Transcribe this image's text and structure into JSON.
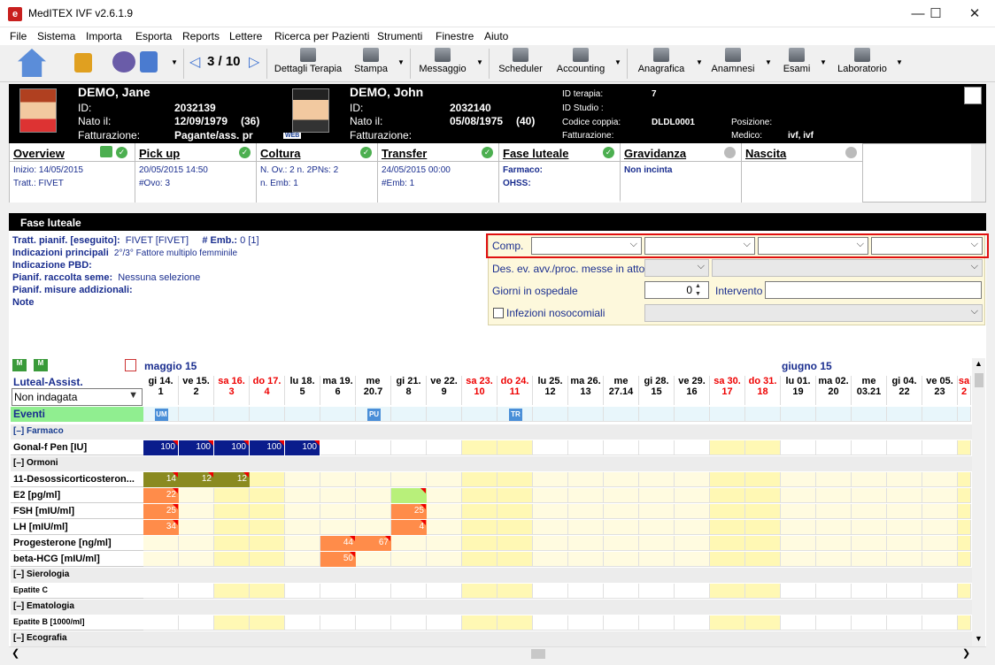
{
  "window": {
    "title": "MedITEX IVF v2.6.1.9",
    "minimize": "—",
    "maximize": "☐",
    "close": "✕"
  },
  "menu": [
    "File",
    "Sistema",
    "Importa",
    "Esporta",
    "Reports",
    "Lettere",
    "Ricerca per Pazienti",
    "Strumenti",
    "Finestre",
    "Aiuto"
  ],
  "toolbar": {
    "counter": "3 / 10",
    "dettagli": "Dettagli Terapia",
    "stampa": "Stampa",
    "messaggio": "Messaggio",
    "scheduler": "Scheduler",
    "accounting": "Accounting",
    "anagrafica": "Anagrafica",
    "anamnesi": "Anamnesi",
    "esami": "Esami",
    "laboratorio": "Laboratorio"
  },
  "female": {
    "name": "DEMO, Jane",
    "id_label": "ID:",
    "id": "2032139",
    "dob_label": "Nato il:",
    "dob": "12/09/1979",
    "age": "(36)",
    "billing_label": "Fatturazione:",
    "billing": "Pagante/ass. pr"
  },
  "male": {
    "name": "DEMO, John",
    "id_label": "ID:",
    "id": "2032140",
    "dob_label": "Nato il:",
    "dob": "05/08/1975",
    "age": "(40)",
    "billing_label": "Fatturazione:",
    "web": "WEB"
  },
  "couple": {
    "therapy_label": "ID terapia:",
    "therapy": "7",
    "study_label": "ID Studio :",
    "code_label": "Codice coppia:",
    "code": "DLDL0001",
    "billing_label": "Fatturazione:",
    "position_label": "Posizione:",
    "doctor_label": "Medico:",
    "doctor": "ivf, ivf"
  },
  "phases": [
    {
      "title": "Overview",
      "l1": "Inizio:  14/05/2015",
      "l2": "Tratt.: FIVET"
    },
    {
      "title": "Pick up",
      "l1": "20/05/2015 14:50",
      "l2": "#Ovo: 3"
    },
    {
      "title": "Coltura",
      "l1": "N. Ov.: 2 n. 2PNs: 2",
      "l2": "n. Emb: 1"
    },
    {
      "title": "Transfer",
      "l1": "24/05/2015 00:00",
      "l2": "#Emb: 1"
    },
    {
      "title": "Fase luteale",
      "l1": "Farmaco:",
      "l2": "OHSS:"
    },
    {
      "title": "Gravidanza",
      "l1": "Non incinta",
      "l2": ""
    },
    {
      "title": "Nascita",
      "l1": "",
      "l2": ""
    }
  ],
  "section": {
    "title": "Fase luteale"
  },
  "info": {
    "tratt_label": "Tratt. pianif. [eseguito]:",
    "tratt": "FIVET    [FIVET]",
    "emb_label": "# Emb.:",
    "emb": "0    [1]",
    "indic_label": "Indicazioni principali",
    "indic": "2°/3° Fattore multiplo femminile",
    "pbd_label": "Indicazione PBD:",
    "seme_label": "Pianif. raccolta seme:",
    "seme": "Nessuna selezione",
    "misure_label": "Pianif. misure addizionali:",
    "note_label": "Note"
  },
  "form": {
    "comp_label": "Comp.",
    "des_label": "Des. ev. avv./proc. messe in atto",
    "giorni_label": "Giorni in ospedale",
    "giorni_value": "0",
    "intervento_label": "Intervento",
    "infezioni_label": "Infezioni nosocomiali"
  },
  "grid": {
    "month1": "maggio 15",
    "month2": "giugno 15",
    "luteal_label": "Luteal-Assist.",
    "luteal_value": "Non indagata",
    "days": [
      {
        "d": "gi 14.",
        "n": "1",
        "we": false
      },
      {
        "d": "ve 15.",
        "n": "2",
        "we": false
      },
      {
        "d": "sa 16.",
        "n": "3",
        "we": true
      },
      {
        "d": "do 17.",
        "n": "4",
        "we": true
      },
      {
        "d": "lu 18.",
        "n": "5",
        "we": false
      },
      {
        "d": "ma 19.",
        "n": "6",
        "we": false
      },
      {
        "d": "me",
        "n": "20.7",
        "we": false
      },
      {
        "d": "gi 21.",
        "n": "8",
        "we": false
      },
      {
        "d": "ve 22.",
        "n": "9",
        "we": false
      },
      {
        "d": "sa 23.",
        "n": "10",
        "we": true
      },
      {
        "d": "do 24.",
        "n": "11",
        "we": true
      },
      {
        "d": "lu 25.",
        "n": "12",
        "we": false
      },
      {
        "d": "ma 26.",
        "n": "13",
        "we": false
      },
      {
        "d": "me",
        "n": "27.14",
        "we": false
      },
      {
        "d": "gi 28.",
        "n": "15",
        "we": false
      },
      {
        "d": "ve 29.",
        "n": "16",
        "we": false
      },
      {
        "d": "sa 30.",
        "n": "17",
        "we": true
      },
      {
        "d": "do 31.",
        "n": "18",
        "we": true
      },
      {
        "d": "lu 01.",
        "n": "19",
        "we": false
      },
      {
        "d": "ma 02.",
        "n": "20",
        "we": false
      },
      {
        "d": "me",
        "n": "03.21",
        "we": false
      },
      {
        "d": "gi 04.",
        "n": "22",
        "we": false
      },
      {
        "d": "ve 05.",
        "n": "23",
        "we": false
      },
      {
        "d": "sa",
        "n": "2",
        "we": true
      }
    ],
    "eventi_label": "Eventi",
    "events": [
      {
        "day": 0,
        "label": "UM"
      },
      {
        "day": 6,
        "label": "PU"
      },
      {
        "day": 10,
        "label": "TR"
      }
    ],
    "farmaco_group": "[–]  Farmaco",
    "gonal_label": "Gonal-f Pen [IU]",
    "gonal_values": [
      "100",
      "100",
      "100",
      "100",
      "100"
    ],
    "ormoni_group": "[–]  Ormoni",
    "hormones": [
      {
        "label": "11-Desossicorticosteron...",
        "values": {
          "0": "14",
          "1": "12",
          "2": "12"
        }
      },
      {
        "label": "E2  [pg/ml]",
        "values": {
          "0": "22"
        }
      },
      {
        "label": "FSH  [mIU/ml]",
        "values": {
          "0": "25",
          "7": "25"
        }
      },
      {
        "label": "LH  [mIU/ml]",
        "values": {
          "0": "34",
          "7": "4"
        }
      },
      {
        "label": "Progesterone  [ng/ml]",
        "values": {
          "5": "44",
          "6": "67"
        }
      },
      {
        "label": "beta-HCG  [mIU/ml]",
        "values": {
          "5": "50"
        }
      }
    ],
    "sierologia_group": "[–]  Sierologia",
    "epatite_c": "Epatite C",
    "ematologia_group": "[–]  Ematologia",
    "epatite_b": "Epatite B  [1000/ml]",
    "ecografia_group": "[–]  Ecografia"
  }
}
